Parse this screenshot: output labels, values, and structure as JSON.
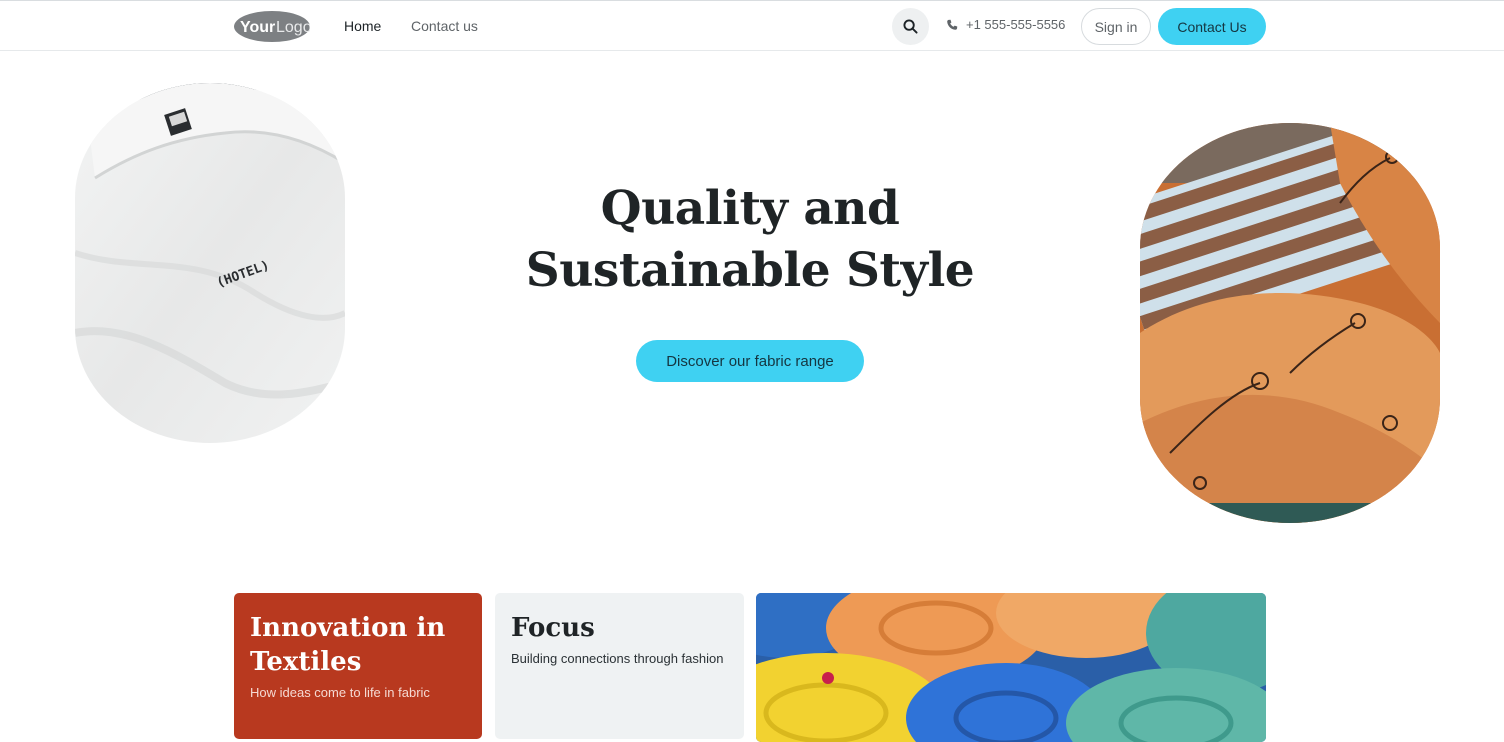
{
  "header": {
    "logo_text": "YourLogo",
    "nav": [
      {
        "label": "Home",
        "active": true
      },
      {
        "label": "Contact us",
        "active": false
      }
    ],
    "search_icon": "search-icon",
    "phone_icon": "phone-icon",
    "phone": "+1 555-555-5556",
    "signin_label": "Sign in",
    "contact_label": "Contact Us"
  },
  "hero": {
    "title_line1": "Quality and",
    "title_line2": "Sustainable Style",
    "cta_label": "Discover our fabric range",
    "left_image_text": "(HOTEL)"
  },
  "cards": [
    {
      "title": "Innovation in Textiles",
      "subtitle": "How ideas come to life in fabric"
    },
    {
      "title": "Focus",
      "subtitle": "Building connections through fashion"
    }
  ],
  "colors": {
    "accent": "#3fd1f2",
    "card_red": "#b8391f",
    "card_grey": "#eff2f3",
    "text_dark": "#1f2426"
  }
}
